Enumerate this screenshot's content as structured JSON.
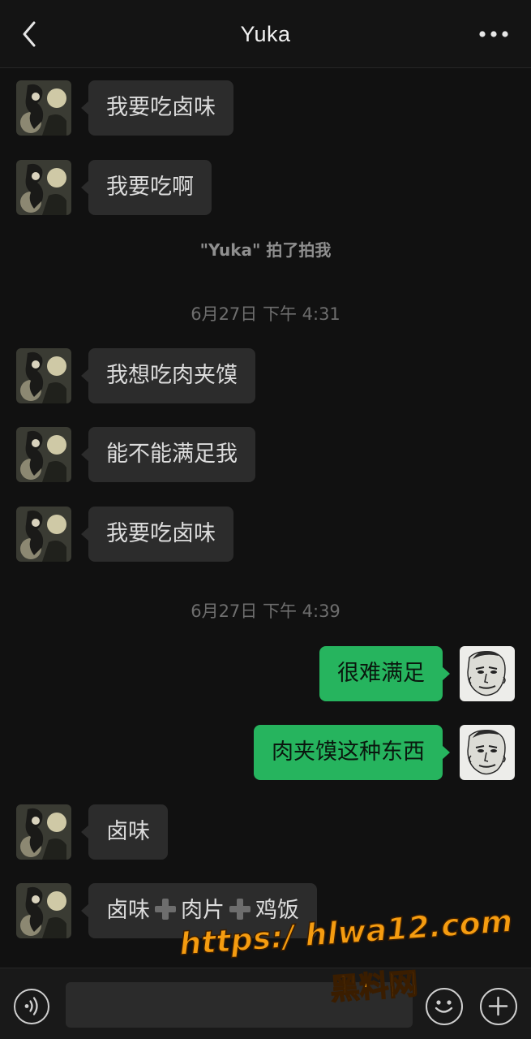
{
  "header": {
    "title": "Yuka",
    "back_icon": "chevron-left-icon",
    "more_icon": "more-dots-icon"
  },
  "messages": [
    {
      "side": "in",
      "text": "我要吃卤味"
    },
    {
      "side": "in",
      "text": "我要吃啊"
    },
    {
      "system": "\"Yuka\" 拍了拍我"
    },
    {
      "timestamp": "6月27日 下午 4:31"
    },
    {
      "side": "in",
      "text": "我想吃肉夹馍"
    },
    {
      "side": "in",
      "text": "能不能满足我"
    },
    {
      "side": "in",
      "text": "我要吃卤味"
    },
    {
      "timestamp": "6月27日 下午 4:39"
    },
    {
      "side": "out",
      "text": "很难满足"
    },
    {
      "side": "out",
      "text": "肉夹馍这种东西"
    },
    {
      "side": "in",
      "text": "卤味"
    },
    {
      "side": "in",
      "parts": [
        "卤味",
        "肉片",
        "鸡饭"
      ]
    }
  ],
  "input": {
    "placeholder": "",
    "value": ""
  },
  "watermark": {
    "url": "https:/ hlwa12.com",
    "label": "黑料网"
  },
  "colors": {
    "background": "#111111",
    "incoming_bubble": "#2c2c2c",
    "outgoing_bubble": "#26b45e",
    "watermark": "#f59c10"
  }
}
